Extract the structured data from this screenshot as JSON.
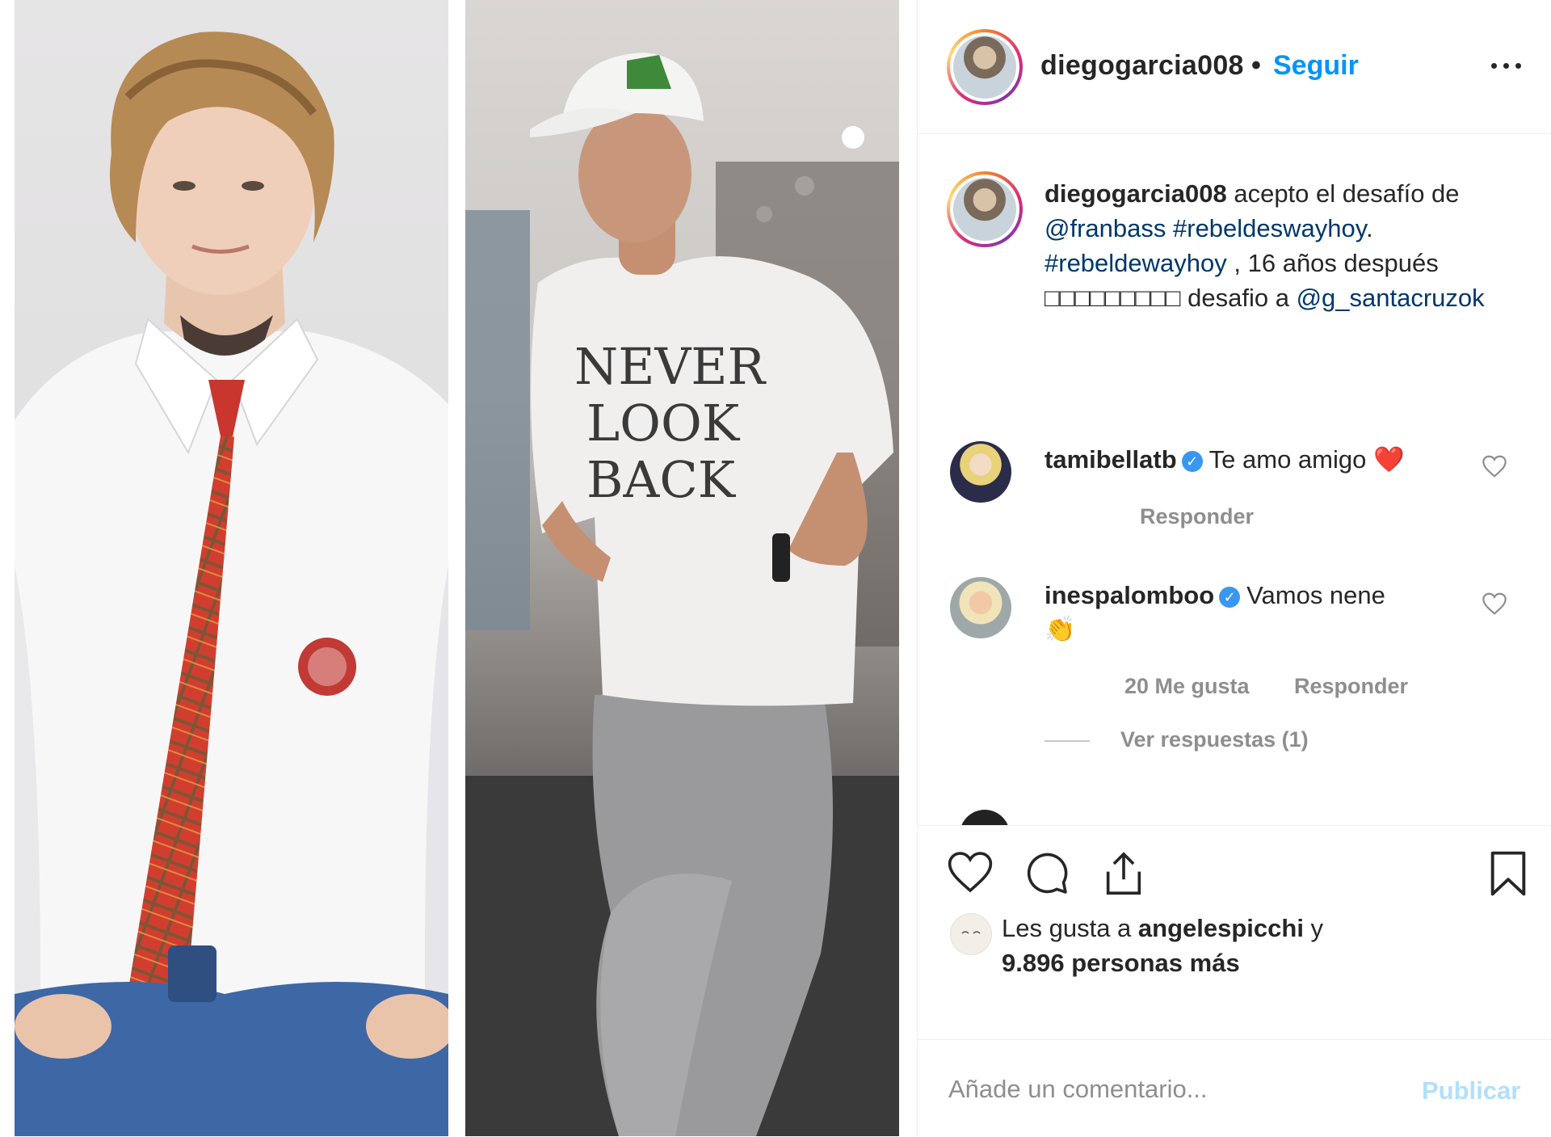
{
  "post": {
    "username": "diegogarcia008",
    "separator": "•",
    "follow_label": "Seguir",
    "more_icon": "more-icon"
  },
  "caption": {
    "username": "diegogarcia008",
    "text_1": " acepto el desafío de ",
    "mention_1": "@franbass",
    "space_1": " ",
    "hashtag_1": "#rebeldeswayhoy",
    "text_2": ". ",
    "hashtag_2": "#rebeldewayhoy",
    "text_3": " , 16 años después ",
    "emoji_boxes": "□□□□□□□□□",
    "text_4": " desafio a ",
    "mention_2": "@g_santacruzok"
  },
  "comments": [
    {
      "username": "tamibellatb",
      "verified": true,
      "text": "Te amo amigo",
      "emoji": "❤️",
      "reply_label": "Responder"
    },
    {
      "username": "inespalomboo",
      "verified": true,
      "text": "Vamos nene",
      "emoji": "👏",
      "likes_label": "20 Me gusta",
      "reply_label": "Responder",
      "view_replies_label": "Ver respuestas (1)"
    }
  ],
  "likes": {
    "prefix": "Les gusta a ",
    "user": "angelespicchi",
    "middle": " y",
    "count_text": "9.896 personas más"
  },
  "add_comment": {
    "placeholder": "Añade un comentario...",
    "publish_label": "Publicar"
  },
  "colors": {
    "link": "#00376b",
    "follow": "#0095f6",
    "verified": "#3897f0",
    "publish_disabled": "#b2dffc",
    "meta": "#8e8e8e"
  }
}
